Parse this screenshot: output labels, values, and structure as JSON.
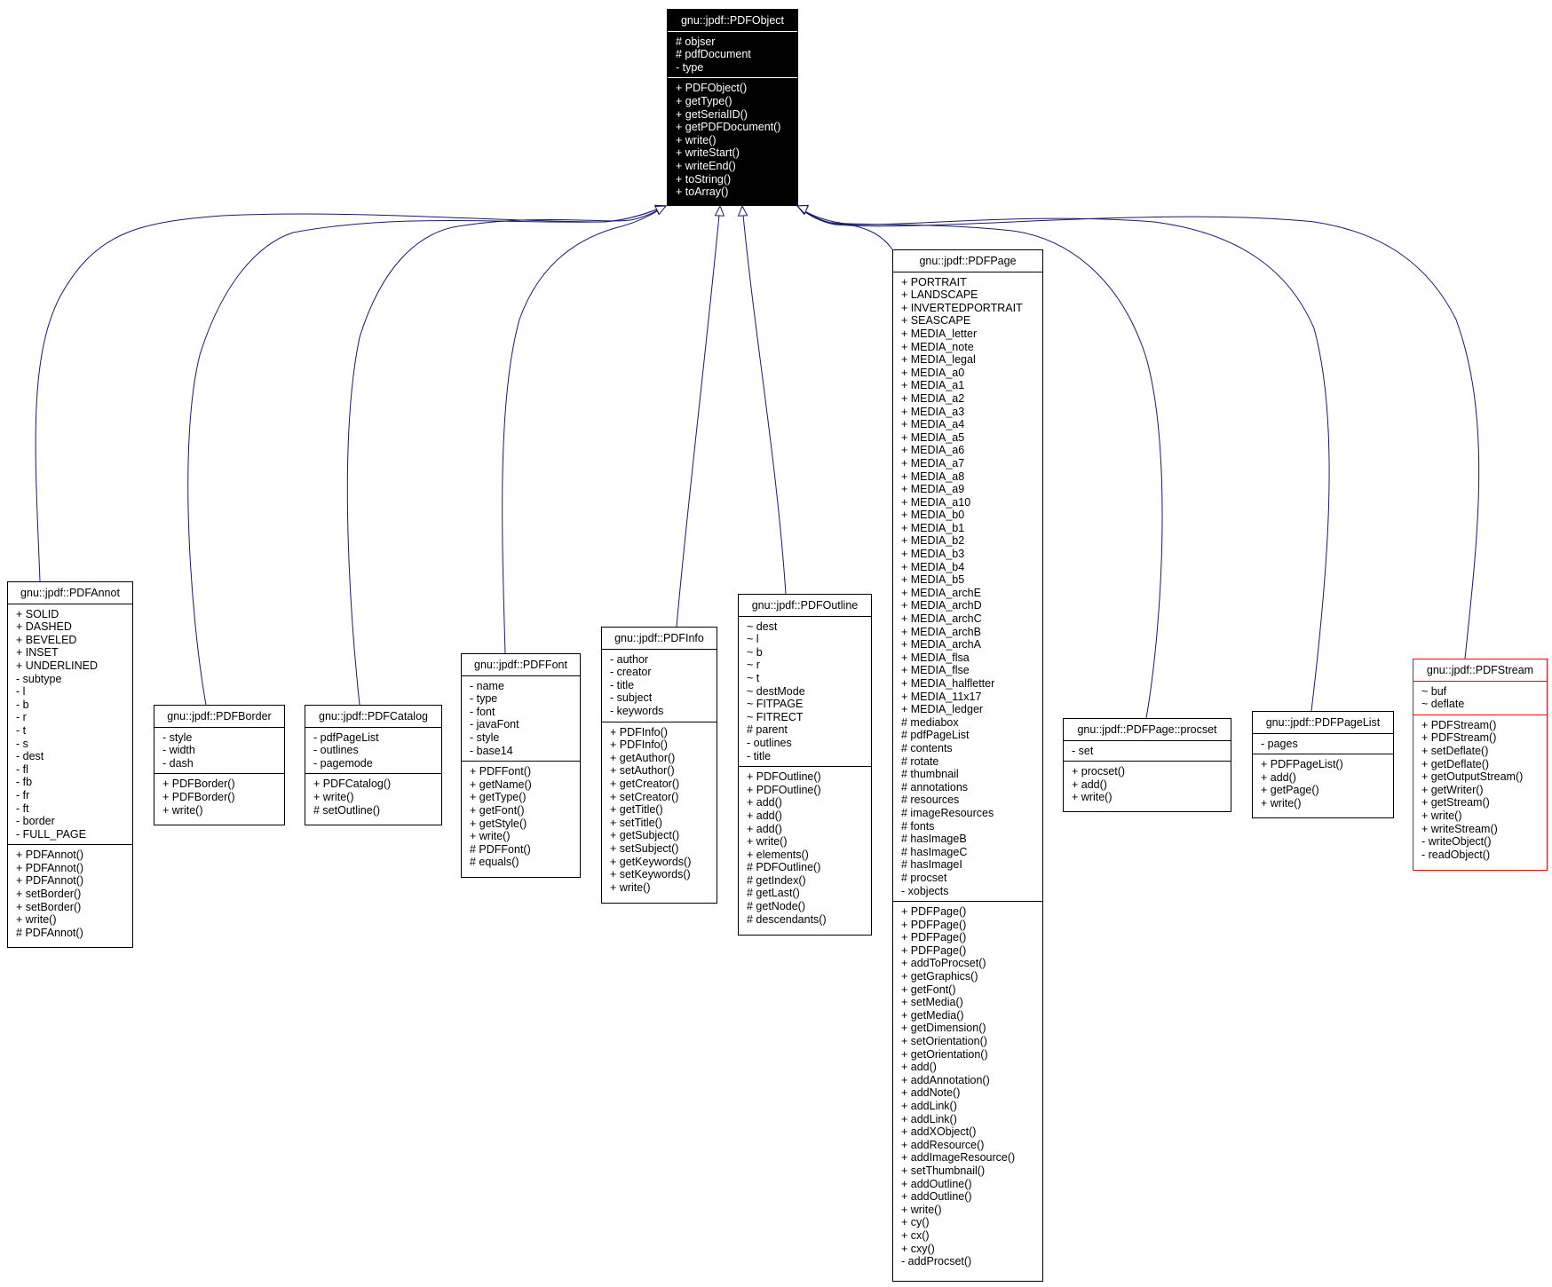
{
  "diagram": {
    "type": "uml-class-inheritance",
    "edge_color": "#191970",
    "highlight_color": "#ff0000",
    "root": {
      "id": "pdfobject",
      "name": "gnu::jpdf::PDFObject",
      "attributes": [
        "# objser",
        "# pdfDocument",
        "- type"
      ],
      "methods": [
        "+ PDFObject()",
        "+ getType()",
        "+ getSerialID()",
        "+ getPDFDocument()",
        "+ write()",
        "+ writeStart()",
        "+ writeEnd()",
        "+ toString()",
        "+ toArray()"
      ]
    },
    "classes": [
      {
        "id": "pdfannot",
        "name": "gnu::jpdf::PDFAnnot",
        "attributes": [
          "+ SOLID",
          "+ DASHED",
          "+ BEVELED",
          "+ INSET",
          "+ UNDERLINED",
          "- subtype",
          "- l",
          "- b",
          "- r",
          "- t",
          "- s",
          "- dest",
          "- fl",
          "- fb",
          "- fr",
          "- ft",
          "- border",
          "- FULL_PAGE"
        ],
        "methods": [
          "+ PDFAnnot()",
          "+ PDFAnnot()",
          "+ PDFAnnot()",
          "+ setBorder()",
          "+ setBorder()",
          "+ write()",
          "# PDFAnnot()"
        ]
      },
      {
        "id": "pdfborder",
        "name": "gnu::jpdf::PDFBorder",
        "attributes": [
          "- style",
          "- width",
          "- dash"
        ],
        "methods": [
          "+ PDFBorder()",
          "+ PDFBorder()",
          "+ write()"
        ]
      },
      {
        "id": "pdfcatalog",
        "name": "gnu::jpdf::PDFCatalog",
        "attributes": [
          "- pdfPageList",
          "- outlines",
          "- pagemode"
        ],
        "methods": [
          "+ PDFCatalog()",
          "+ write()",
          "# setOutline()"
        ]
      },
      {
        "id": "pdffont",
        "name": "gnu::jpdf::PDFFont",
        "attributes": [
          "- name",
          "- type",
          "- font",
          "- javaFont",
          "- style",
          "- base14"
        ],
        "methods": [
          "+ PDFFont()",
          "+ getName()",
          "+ getType()",
          "+ getFont()",
          "+ getStyle()",
          "+ write()",
          "# PDFFont()",
          "# equals()"
        ]
      },
      {
        "id": "pdfinfo",
        "name": "gnu::jpdf::PDFInfo",
        "attributes": [
          "- author",
          "- creator",
          "- title",
          "- subject",
          "- keywords"
        ],
        "methods": [
          "+ PDFInfo()",
          "+ PDFInfo()",
          "+ getAuthor()",
          "+ setAuthor()",
          "+ getCreator()",
          "+ setCreator()",
          "+ getTitle()",
          "+ setTitle()",
          "+ getSubject()",
          "+ setSubject()",
          "+ getKeywords()",
          "+ setKeywords()",
          "+ write()"
        ]
      },
      {
        "id": "pdfoutline",
        "name": "gnu::jpdf::PDFOutline",
        "attributes": [
          "~ dest",
          "~ l",
          "~ b",
          "~ r",
          "~ t",
          "~ destMode",
          "~ FITPAGE",
          "~ FITRECT",
          "# parent",
          "- outlines",
          "- title"
        ],
        "methods": [
          "+ PDFOutline()",
          "+ PDFOutline()",
          "+ add()",
          "+ add()",
          "+ add()",
          "+ write()",
          "+ elements()",
          "# PDFOutline()",
          "# getIndex()",
          "# getLast()",
          "# getNode()",
          "# descendants()"
        ]
      },
      {
        "id": "pdfpage",
        "name": "gnu::jpdf::PDFPage",
        "attributes": [
          "+ PORTRAIT",
          "+ LANDSCAPE",
          "+ INVERTEDPORTRAIT",
          "+ SEASCAPE",
          "+ MEDIA_letter",
          "+ MEDIA_note",
          "+ MEDIA_legal",
          "+ MEDIA_a0",
          "+ MEDIA_a1",
          "+ MEDIA_a2",
          "+ MEDIA_a3",
          "+ MEDIA_a4",
          "+ MEDIA_a5",
          "+ MEDIA_a6",
          "+ MEDIA_a7",
          "+ MEDIA_a8",
          "+ MEDIA_a9",
          "+ MEDIA_a10",
          "+ MEDIA_b0",
          "+ MEDIA_b1",
          "+ MEDIA_b2",
          "+ MEDIA_b3",
          "+ MEDIA_b4",
          "+ MEDIA_b5",
          "+ MEDIA_archE",
          "+ MEDIA_archD",
          "+ MEDIA_archC",
          "+ MEDIA_archB",
          "+ MEDIA_archA",
          "+ MEDIA_flsa",
          "+ MEDIA_flse",
          "+ MEDIA_halfletter",
          "+ MEDIA_11x17",
          "+ MEDIA_ledger",
          "# mediabox",
          "# pdfPageList",
          "# contents",
          "# rotate",
          "# thumbnail",
          "# annotations",
          "# resources",
          "# imageResources",
          "# fonts",
          "# hasImageB",
          "# hasImageC",
          "# hasImageI",
          "# procset",
          "- xobjects"
        ],
        "methods": [
          "+ PDFPage()",
          "+ PDFPage()",
          "+ PDFPage()",
          "+ PDFPage()",
          "+ addToProcset()",
          "+ getGraphics()",
          "+ getFont()",
          "+ setMedia()",
          "+ getMedia()",
          "+ getDimension()",
          "+ setOrientation()",
          "+ getOrientation()",
          "+ add()",
          "+ addAnnotation()",
          "+ addNote()",
          "+ addLink()",
          "+ addLink()",
          "+ addXObject()",
          "+ addResource()",
          "+ addImageResource()",
          "+ setThumbnail()",
          "+ addOutline()",
          "+ addOutline()",
          "+ write()",
          "+ cy()",
          "+ cx()",
          "+ cxy()",
          "- addProcset()"
        ]
      },
      {
        "id": "procset",
        "name": "gnu::jpdf::PDFPage::procset",
        "attributes": [
          "- set"
        ],
        "methods": [
          "+ procset()",
          "+ add()",
          "+ write()"
        ]
      },
      {
        "id": "pdfpagelist",
        "name": "gnu::jpdf::PDFPageList",
        "attributes": [
          "- pages"
        ],
        "methods": [
          "+ PDFPageList()",
          "+ add()",
          "+ getPage()",
          "+ write()"
        ]
      },
      {
        "id": "pdfstream",
        "name": "gnu::jpdf::PDFStream",
        "highlighted": true,
        "attributes": [
          "~ buf",
          "~ deflate"
        ],
        "methods": [
          "+ PDFStream()",
          "+ PDFStream()",
          "+ setDeflate()",
          "+ getDeflate()",
          "+ getOutputStream()",
          "+ getWriter()",
          "+ getStream()",
          "+ write()",
          "+ writeStream()",
          "- writeObject()",
          "- readObject()"
        ]
      }
    ],
    "edges": [
      {
        "from": "pdfannot",
        "to": "pdfobject",
        "kind": "generalization"
      },
      {
        "from": "pdfborder",
        "to": "pdfobject",
        "kind": "generalization"
      },
      {
        "from": "pdfcatalog",
        "to": "pdfobject",
        "kind": "generalization"
      },
      {
        "from": "pdffont",
        "to": "pdfobject",
        "kind": "generalization"
      },
      {
        "from": "pdfinfo",
        "to": "pdfobject",
        "kind": "generalization"
      },
      {
        "from": "pdfoutline",
        "to": "pdfobject",
        "kind": "generalization"
      },
      {
        "from": "pdfpage",
        "to": "pdfobject",
        "kind": "generalization"
      },
      {
        "from": "procset",
        "to": "pdfobject",
        "kind": "generalization"
      },
      {
        "from": "pdfpagelist",
        "to": "pdfobject",
        "kind": "generalization"
      },
      {
        "from": "pdfstream",
        "to": "pdfobject",
        "kind": "generalization"
      }
    ]
  }
}
